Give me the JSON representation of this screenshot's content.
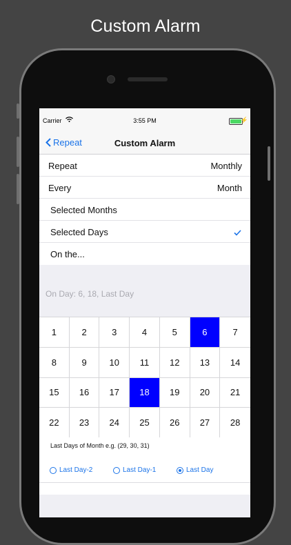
{
  "promo": {
    "title": "Custom Alarm"
  },
  "status_bar": {
    "carrier": "Carrier",
    "time": "3:55 PM"
  },
  "nav": {
    "back_label": "Repeat",
    "title": "Custom Alarm"
  },
  "settings": {
    "repeat": {
      "label": "Repeat",
      "value": "Monthly"
    },
    "every": {
      "label": "Every",
      "value": "Month"
    },
    "selected_months": {
      "label": "Selected Months"
    },
    "selected_days": {
      "label": "Selected Days",
      "checked": true
    },
    "on_the": {
      "label": "On the..."
    }
  },
  "summary": "On Day: 6, 18, Last Day",
  "days": [
    {
      "n": "1",
      "sel": false
    },
    {
      "n": "2",
      "sel": false
    },
    {
      "n": "3",
      "sel": false
    },
    {
      "n": "4",
      "sel": false
    },
    {
      "n": "5",
      "sel": false
    },
    {
      "n": "6",
      "sel": true
    },
    {
      "n": "7",
      "sel": false
    },
    {
      "n": "8",
      "sel": false
    },
    {
      "n": "9",
      "sel": false
    },
    {
      "n": "10",
      "sel": false
    },
    {
      "n": "11",
      "sel": false
    },
    {
      "n": "12",
      "sel": false
    },
    {
      "n": "13",
      "sel": false
    },
    {
      "n": "14",
      "sel": false
    },
    {
      "n": "15",
      "sel": false
    },
    {
      "n": "16",
      "sel": false
    },
    {
      "n": "17",
      "sel": false
    },
    {
      "n": "18",
      "sel": true
    },
    {
      "n": "19",
      "sel": false
    },
    {
      "n": "20",
      "sel": false
    },
    {
      "n": "21",
      "sel": false
    },
    {
      "n": "22",
      "sel": false
    },
    {
      "n": "23",
      "sel": false
    },
    {
      "n": "24",
      "sel": false
    },
    {
      "n": "25",
      "sel": false
    },
    {
      "n": "26",
      "sel": false
    },
    {
      "n": "27",
      "sel": false
    },
    {
      "n": "28",
      "sel": false
    }
  ],
  "last_days": {
    "hint": "Last Days of Month e.g. (29, 30, 31)",
    "options": [
      {
        "label": "Last Day-2",
        "selected": false
      },
      {
        "label": "Last Day-1",
        "selected": false
      },
      {
        "label": "Last Day",
        "selected": true
      }
    ]
  },
  "colors": {
    "accent": "#1a73e8",
    "selected_day": "#0000ff",
    "battery": "#4cd964"
  }
}
